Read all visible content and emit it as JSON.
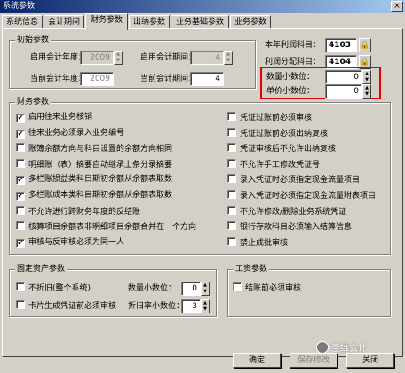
{
  "window": {
    "title": "系统参数",
    "close_label": "×"
  },
  "tabs": [
    "系统信息",
    "会计期间",
    "财务参数",
    "出纳参数",
    "业务基础参数",
    "业务参数"
  ],
  "initial": {
    "title": "初始参数",
    "start_year_label": "启用会计年度：",
    "start_year": "2009",
    "start_period_label": "启用会计期间：",
    "start_period": "4",
    "current_year_label": "当前会计年度：",
    "current_year": "2009",
    "current_period_label": "当前会计期间：",
    "current_period": "4"
  },
  "right": {
    "profit_label": "本年利润科目：",
    "profit_value": "4103",
    "distribution_label": "利润分配科目：",
    "distribution_value": "4104",
    "qty_decimal_label": "数量小数位：",
    "qty_decimal": "0",
    "price_decimal_label": "单价小数位：",
    "price_decimal": "0"
  },
  "finance": {
    "title": "财务参数",
    "left_items": [
      {
        "label": "启用往来业务核销",
        "checked": true
      },
      {
        "label": "往来业务必须录入业务编号",
        "checked": true
      },
      {
        "label": "账簿余额方向与科目设置的余额方向相同",
        "checked": false
      },
      {
        "label": "明细账（表）摘要自动继承上条分录摘要",
        "checked": false
      },
      {
        "label": "多栏账损益类科目期初余额从余额表取数",
        "checked": true
      },
      {
        "label": "多栏账成本类科目期初余额从余额表取数",
        "checked": true
      },
      {
        "label": "不允许进行跨财务年度的反结账",
        "checked": false
      },
      {
        "label": "核算项目余额表非明细项目余额合并在一个方向",
        "checked": false
      },
      {
        "label": "审核与反审核必须为同一人",
        "checked": true
      }
    ],
    "right_items": [
      {
        "label": "凭证过账前必须审核",
        "checked": false
      },
      {
        "label": "凭证过账前必须出纳复核",
        "checked": false
      },
      {
        "label": "凭证审核后不允许出纳复核",
        "checked": false
      },
      {
        "label": "不允许手工修改凭证号",
        "checked": false
      },
      {
        "label": "录入凭证时必须指定现金流量项目",
        "checked": false
      },
      {
        "label": "录入凭证时必须指定现金流量附表项目",
        "checked": false
      },
      {
        "label": "不允许修改/删除业务系统凭证",
        "checked": false
      },
      {
        "label": "银行存款科目必须输入结算信息",
        "checked": false
      },
      {
        "label": "禁止成批审核",
        "checked": false
      }
    ]
  },
  "fixed_assets": {
    "title": "固定资产参数",
    "no_depreciation_label": "不折旧(整个系统)",
    "card_audit_label": "卡片生成凭证前必须审核",
    "qty_decimal_label": "数量小数位：",
    "qty_decimal": "0",
    "dep_decimal_label": "折旧率小数位：",
    "dep_decimal": "3"
  },
  "payroll": {
    "title": "工资参数",
    "settle_label": "结账前必须审核"
  },
  "buttons": {
    "ok": "确定",
    "save": "保存修改",
    "close": "关闭"
  },
  "watermark": "圣维会计",
  "icons": {
    "check": "✔",
    "lock": "🔒",
    "spin_up": "▲",
    "spin_down": "▼"
  }
}
